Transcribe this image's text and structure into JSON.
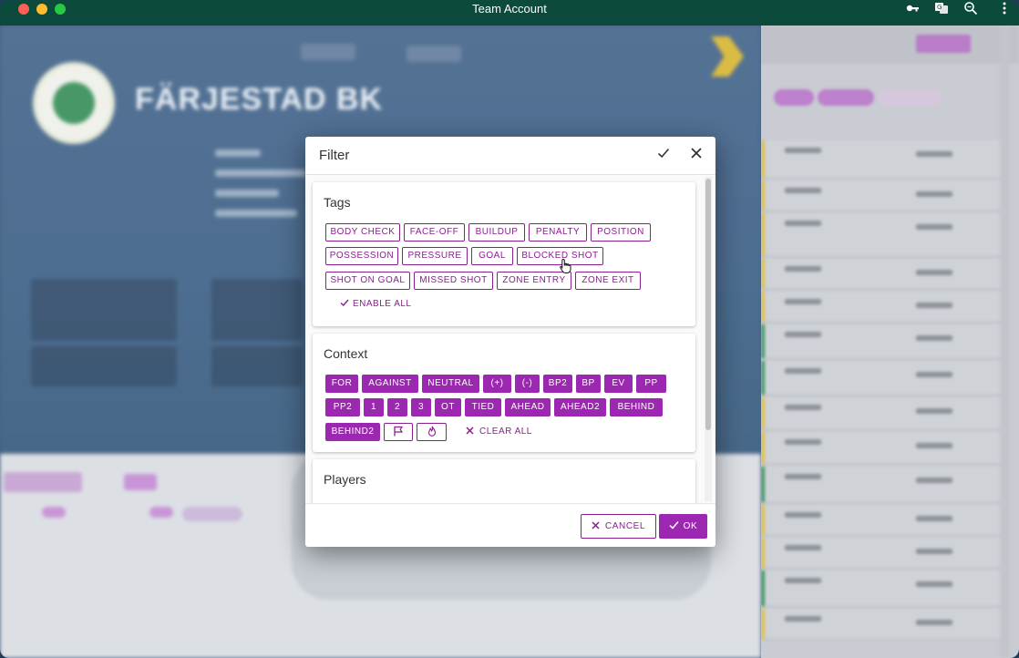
{
  "window": {
    "title": "Team Account"
  },
  "titlebar_icons": [
    "key-icon",
    "translate-icon",
    "zoom-icon",
    "more-vert-icon"
  ],
  "background": {
    "team_name": "FÄRJESTAD BK"
  },
  "dialog": {
    "title": "Filter",
    "sections": {
      "tags": {
        "title": "Tags",
        "chips": [
          "BODY CHECK",
          "FACE-OFF",
          "BUILDUP",
          "PENALTY",
          "POSITION",
          "POSSESSION",
          "PRESSURE",
          "GOAL",
          "BLOCKED SHOT",
          "SHOT ON GOAL",
          "MISSED SHOT",
          "ZONE ENTRY",
          "ZONE EXIT"
        ],
        "action": "ENABLE ALL"
      },
      "context": {
        "title": "Context",
        "chips": [
          "FOR",
          "AGAINST",
          "NEUTRAL",
          "(+)",
          "(-)",
          "BP2",
          "BP",
          "EV",
          "PP",
          "PP2",
          "1",
          "2",
          "3",
          "OT",
          "TIED",
          "AHEAD",
          "AHEAD2",
          "BEHIND",
          "BEHIND2"
        ],
        "action": "CLEAR ALL"
      },
      "players": {
        "title": "Players"
      }
    },
    "footer": {
      "cancel": "CANCEL",
      "ok": "OK"
    }
  },
  "colors": {
    "accent": "#9c27b0",
    "accent_dark": "#8a1e8f",
    "titlebar": "#0c4a3c"
  }
}
